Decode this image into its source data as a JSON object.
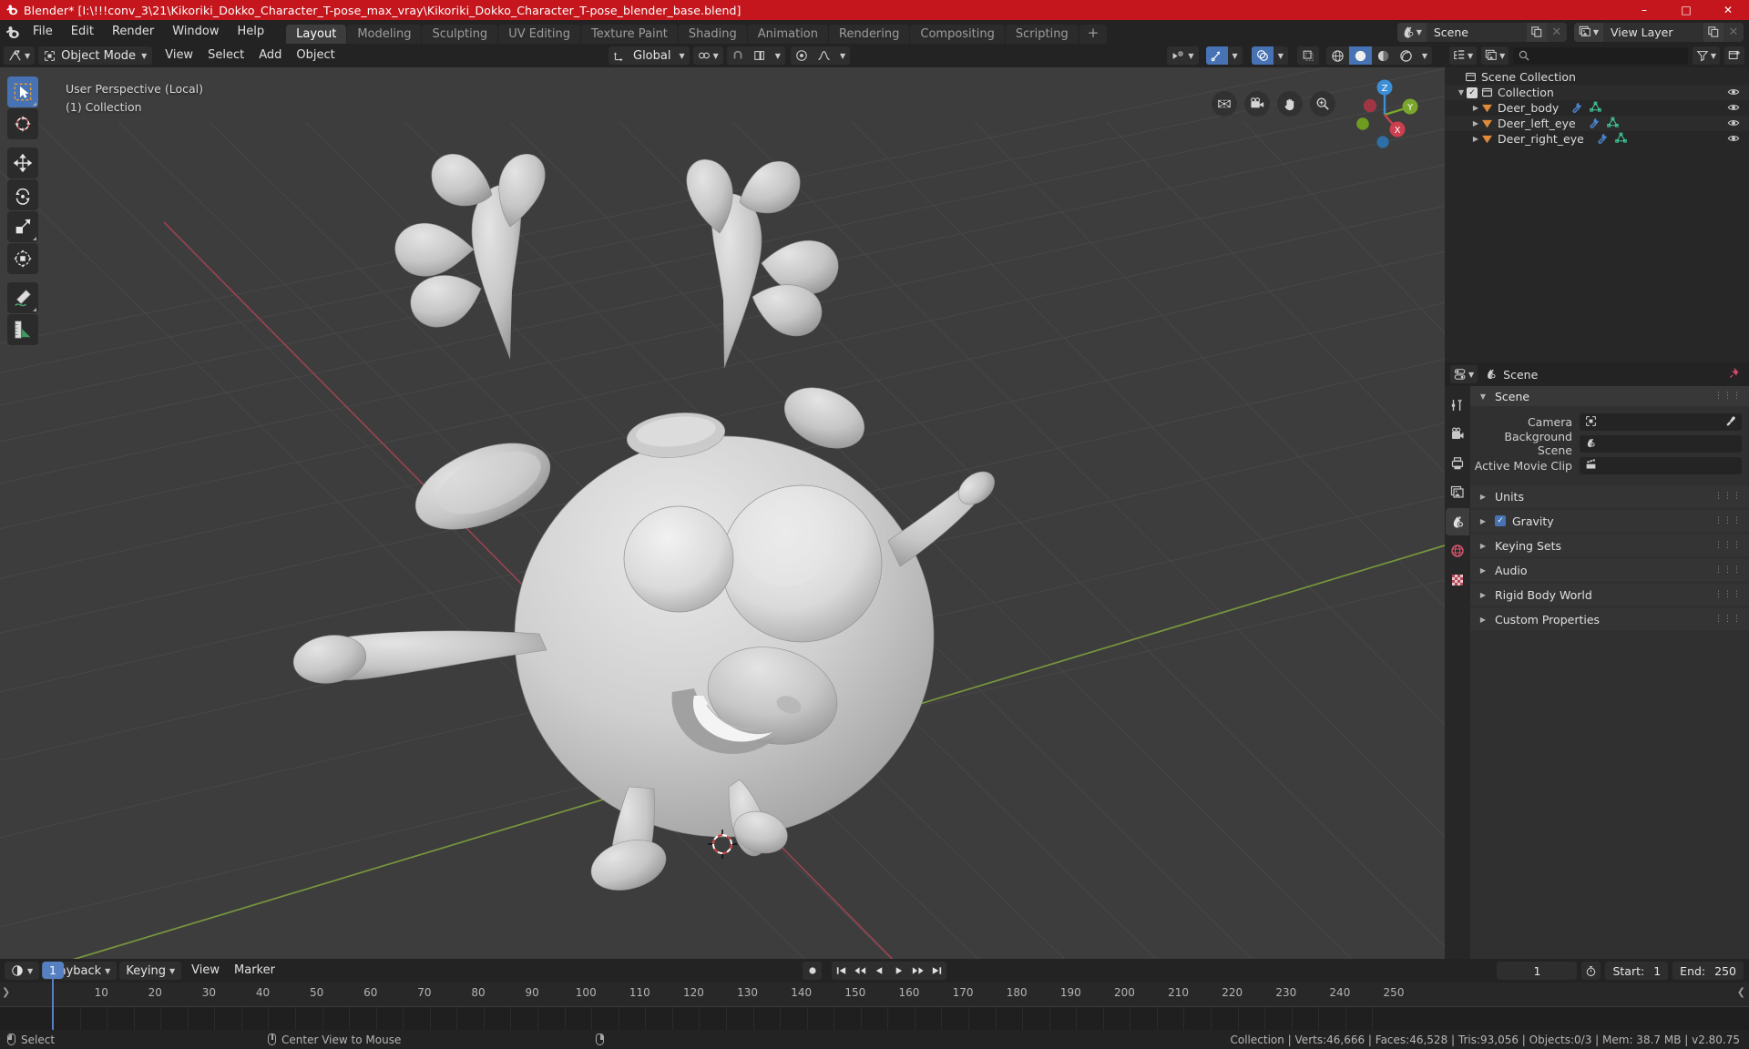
{
  "window": {
    "title": "Blender* [I:\\!!!conv_3\\21\\Kikoriki_Dokko_Character_T-pose_max_vray\\Kikoriki_Dokko_Character_T-pose_blender_base.blend]",
    "minimize": "–",
    "maximize": "□",
    "close": "✕",
    "titlebar_color": "#c4161c"
  },
  "topbar": {
    "menus": [
      "File",
      "Edit",
      "Render",
      "Window",
      "Help"
    ],
    "workspaces": [
      {
        "label": "Layout",
        "active": true
      },
      {
        "label": "Modeling",
        "active": false
      },
      {
        "label": "Sculpting",
        "active": false
      },
      {
        "label": "UV Editing",
        "active": false
      },
      {
        "label": "Texture Paint",
        "active": false
      },
      {
        "label": "Shading",
        "active": false
      },
      {
        "label": "Animation",
        "active": false
      },
      {
        "label": "Rendering",
        "active": false
      },
      {
        "label": "Compositing",
        "active": false
      },
      {
        "label": "Scripting",
        "active": false
      }
    ],
    "add_workspace": "+",
    "scene_name": "Scene",
    "view_layer_name": "View Layer"
  },
  "viewport": {
    "mode": "Object Mode",
    "menus": [
      "View",
      "Select",
      "Add",
      "Object"
    ],
    "transform_orientation": "Global",
    "overlay_line1": "User Perspective (Local)",
    "overlay_line2": "(1) Collection",
    "gizmo_axes": {
      "x": "X",
      "y": "Y",
      "z": "Z"
    },
    "tools": [
      "select-box-tool",
      "cursor-tool",
      "move-tool",
      "rotate-tool",
      "scale-tool",
      "transform-tool",
      "annotate-tool",
      "measure-tool"
    ],
    "nav_buttons": [
      "toggle-camera-view-icon",
      "camera-view-icon",
      "pan-view-icon",
      "zoom-view-icon"
    ],
    "background_color": "#3d3d3d",
    "grid_color": "#4a4a4a",
    "axis_x_color": "#98424b",
    "axis_y_color": "#7f9e3f"
  },
  "outliner": {
    "search_placeholder": "",
    "display_mode": "View Layer",
    "rows": [
      {
        "label": "Scene Collection",
        "depth": 0,
        "icon": "collection-icon",
        "has_tri": false,
        "has_checkbox": false,
        "eye": false,
        "mods": []
      },
      {
        "label": "Collection",
        "depth": 1,
        "icon": "collection-icon",
        "has_tri": true,
        "has_checkbox": true,
        "eye": true,
        "mods": []
      },
      {
        "label": "Deer_body",
        "depth": 2,
        "icon": "mesh-object-icon",
        "has_tri": true,
        "has_checkbox": false,
        "eye": true,
        "mods": [
          "modifier-icon",
          "mesh-data-icon"
        ]
      },
      {
        "label": "Deer_left_eye",
        "depth": 2,
        "icon": "mesh-object-icon",
        "has_tri": true,
        "has_checkbox": false,
        "eye": true,
        "mods": [
          "modifier-icon",
          "mesh-data-icon"
        ]
      },
      {
        "label": "Deer_right_eye",
        "depth": 2,
        "icon": "mesh-object-icon",
        "has_tri": true,
        "has_checkbox": false,
        "eye": true,
        "mods": [
          "modifier-icon",
          "mesh-data-icon"
        ]
      }
    ]
  },
  "properties": {
    "breadcrumb": "Scene",
    "tabs": [
      "tool-tab",
      "render-tab",
      "output-tab",
      "view-layer-tab",
      "scene-tab",
      "world-tab",
      "texture-tab"
    ],
    "active_tab_index": 4,
    "panel_title": "Scene",
    "fields": [
      {
        "label": "Camera",
        "value": "",
        "icon": "camera-icon",
        "eyedropper": true
      },
      {
        "label": "Background Scene",
        "value": "",
        "icon": "scene-icon",
        "eyedropper": false
      },
      {
        "label": "Active Movie Clip",
        "value": "",
        "icon": "clip-icon",
        "eyedropper": false
      }
    ],
    "sections": [
      {
        "label": "Units",
        "checkbox": false,
        "checked": false
      },
      {
        "label": "Gravity",
        "checkbox": true,
        "checked": true
      },
      {
        "label": "Keying Sets",
        "checkbox": false,
        "checked": false
      },
      {
        "label": "Audio",
        "checkbox": false,
        "checked": false
      },
      {
        "label": "Rigid Body World",
        "checkbox": false,
        "checked": false
      },
      {
        "label": "Custom Properties",
        "checkbox": false,
        "checked": false
      }
    ]
  },
  "timeline": {
    "menus": [
      "View",
      "Marker"
    ],
    "dropdowns": [
      "Playback",
      "Keying"
    ],
    "current_frame": "1",
    "start_label": "Start:",
    "start_value": "1",
    "end_label": "End:",
    "end_value": "250",
    "ticks": [
      "1",
      "10",
      "20",
      "30",
      "40",
      "50",
      "60",
      "70",
      "80",
      "90",
      "100",
      "110",
      "120",
      "130",
      "140",
      "150",
      "160",
      "170",
      "180",
      "190",
      "200",
      "210",
      "220",
      "230",
      "240",
      "250"
    ],
    "playhead_label": "1",
    "transport": [
      "jump-start-icon",
      "prev-keyframe-icon",
      "play-reverse-icon",
      "play-icon",
      "next-keyframe-icon",
      "jump-end-icon"
    ],
    "record_icon": "auto-keying-icon"
  },
  "statusbar": {
    "left_mouse_action": "Select",
    "middle_mouse_action": "Center View to Mouse",
    "right_mouse_action": "",
    "stats": "Collection | Verts:46,666 | Faces:46,528 | Tris:93,056 | Objects:0/3 | Mem: 38.7 MB | v2.80.75"
  }
}
